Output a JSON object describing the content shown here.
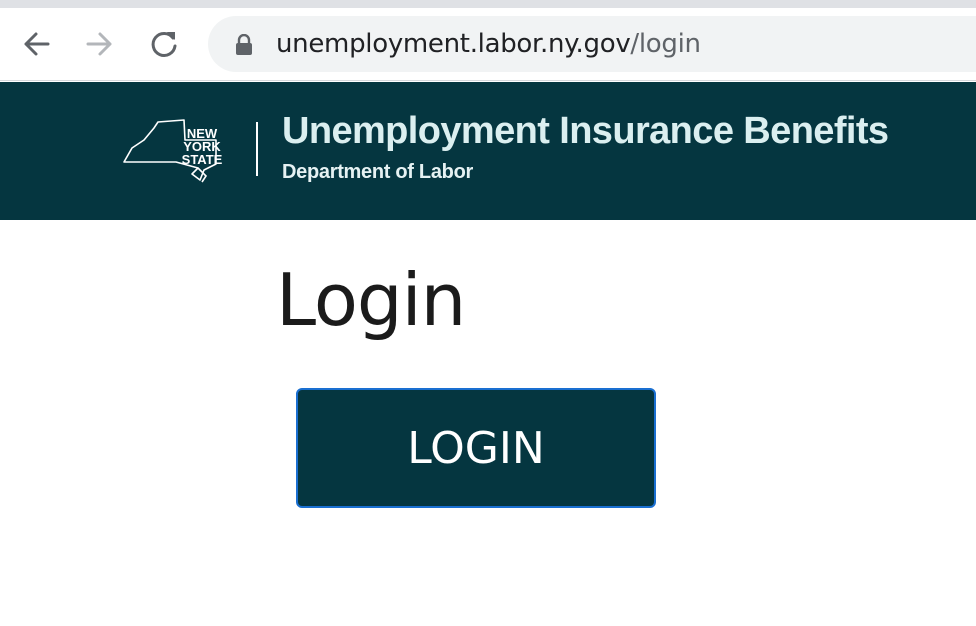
{
  "browser": {
    "url_host": "unemployment.labor.ny.gov",
    "url_path": "/login",
    "icons": {
      "back": "back-arrow-icon",
      "forward": "forward-arrow-icon",
      "reload": "reload-icon",
      "lock": "lock-icon"
    }
  },
  "header": {
    "logo_lines": [
      "NEW",
      "YORK",
      "STATE"
    ],
    "title": "Unemployment Insurance Benefits",
    "subtitle": "Department of Labor",
    "colors": {
      "background": "#053640",
      "title": "#dbeff0"
    }
  },
  "main": {
    "page_title": "Login",
    "login_button_label": "LOGIN",
    "colors": {
      "button_bg": "#053640",
      "button_border": "#1a6fd1"
    }
  }
}
